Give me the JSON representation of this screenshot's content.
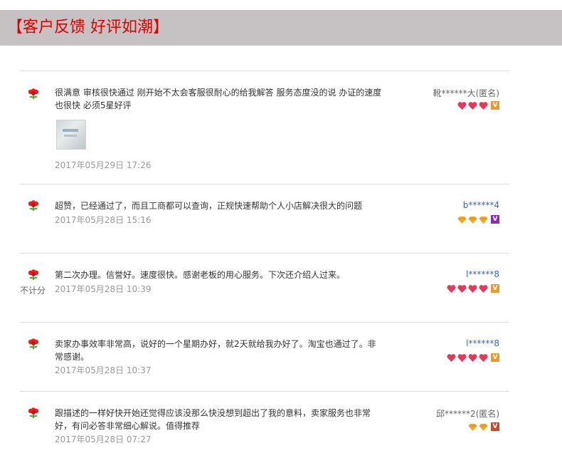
{
  "header": {
    "title": "【客户反馈 好评如潮】"
  },
  "colors": {
    "accent": "#e10000",
    "header_bg": "#c6c2c3",
    "user_blue": "#3366cc",
    "heart_red": "#e8385a",
    "diamond_orange": "#f5a623"
  },
  "reviews": [
    {
      "icon": "flower-icon",
      "text": "很满意 审核很快通过 刚开始不太会客服很耐心的给我解答 服务态度没的说 办证的速度也很快 必须5星好评",
      "date": "2017年05月29日 17:26",
      "user": "靴******大(匿名)",
      "badge_type": "heart",
      "badge_count": 3,
      "level_icon": "orange-level-icon"
    },
    {
      "icon": "flower-icon",
      "text": "超赞，已经通过了，而且工商都可以查询，正规快速帮助个人小店解决很大的问题",
      "date": "2017年05月28日 15:16",
      "user": "b******4",
      "badge_type": "diamond",
      "badge_count": 3,
      "level_icon": "purple-level-icon"
    },
    {
      "icon": "flower-icon",
      "note": "不计分",
      "text": "第二次办理。信誉好。速度很快。感谢老板的用心服务。下次还介绍人过来。",
      "date": "2017年05月28日 10:39",
      "user": "l******8",
      "badge_type": "heart",
      "badge_count": 4,
      "level_icon": "orange-level-icon"
    },
    {
      "icon": "flower-icon",
      "text": "卖家办事效率非常高，说好的一个星期办好，就2天就给我办好了。淘宝也通过了。非常感谢。",
      "date": "2017年05月28日 10:37",
      "user": "l******8",
      "badge_type": "heart",
      "badge_count": 4,
      "level_icon": "orange-level-icon"
    },
    {
      "icon": "flower-icon",
      "text": "跟描述的一样好快开始还觉得应该没那么快没想到超出了我的意料，卖家服务也非常好，有问必答非常细心解说。值得推荐",
      "date": "2017年05月28日 07:27",
      "user": "邱******2(匿名)",
      "badge_type": "diamond",
      "badge_count": 2,
      "level_icon": "red-level-icon"
    }
  ]
}
